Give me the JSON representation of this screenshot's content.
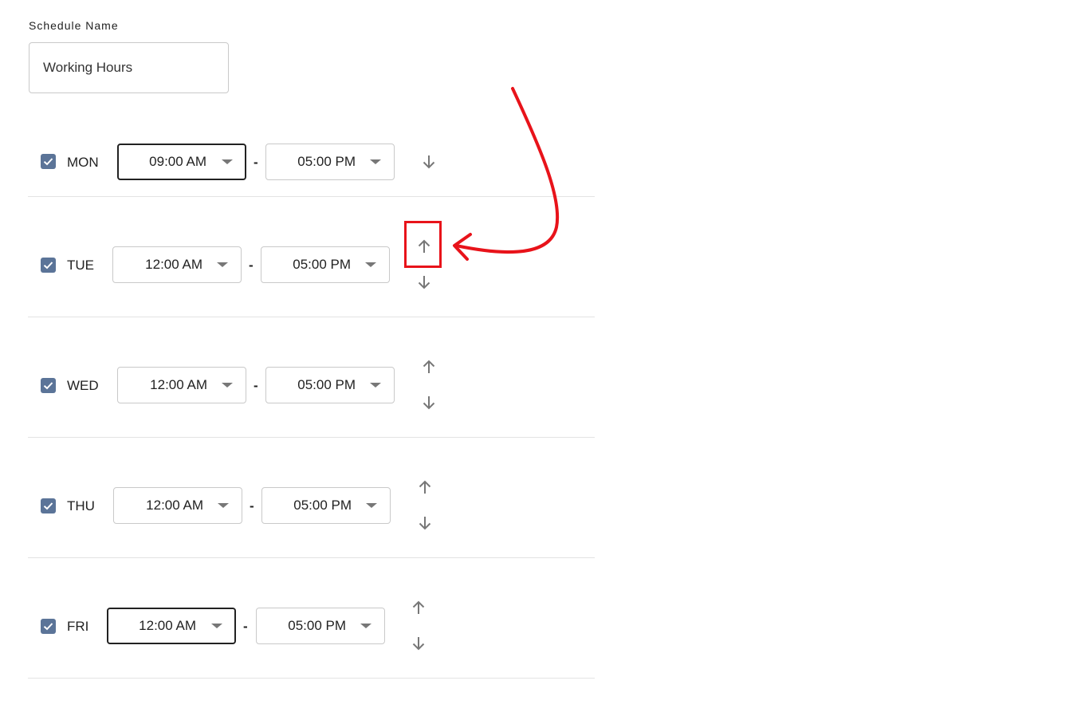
{
  "form": {
    "schedule_name_label": "Schedule Name",
    "schedule_name_value": "Working Hours"
  },
  "days": [
    {
      "day": "MON",
      "checked": true,
      "start": "09:00 AM",
      "end": "05:00 PM",
      "separator": "-",
      "move_up": false,
      "move_down": true,
      "start_focused": true
    },
    {
      "day": "TUE",
      "checked": true,
      "start": "12:00 AM",
      "end": "05:00 PM",
      "separator": "-",
      "move_up": true,
      "move_down": true
    },
    {
      "day": "WED",
      "checked": true,
      "start": "12:00 AM",
      "end": "05:00 PM",
      "separator": "-",
      "move_up": true,
      "move_down": true
    },
    {
      "day": "THU",
      "checked": true,
      "start": "12:00 AM",
      "end": "05:00 PM",
      "separator": "-",
      "move_up": true,
      "move_down": true
    },
    {
      "day": "FRI",
      "checked": true,
      "start": "12:00 AM",
      "end": "05:00 PM",
      "separator": "-",
      "move_up": true,
      "move_down": true,
      "start_focused": true
    }
  ],
  "icons": {
    "checkbox": "check-icon",
    "dropdown": "caret-down-icon",
    "move_up": "arrow-up-icon",
    "move_down": "arrow-down-icon"
  },
  "annotation": {
    "target": "TUE move-up arrow",
    "color": "#e8131a"
  }
}
